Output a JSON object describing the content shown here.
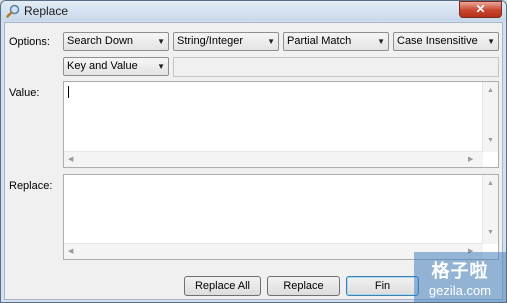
{
  "window": {
    "title": "Replace",
    "close_glyph": "✕"
  },
  "options": {
    "label": "Options:",
    "direction": "Search Down",
    "data_type": "String/Integer",
    "match": "Partial Match",
    "case": "Case Insensitive",
    "scope": "Key and Value",
    "extra_field_value": ""
  },
  "value": {
    "label": "Value:",
    "text": ""
  },
  "replace": {
    "label": "Replace:",
    "text": ""
  },
  "buttons": {
    "replace_all": "Replace All",
    "replace": "Replace",
    "find": "Fin"
  },
  "watermark": {
    "text": "格子啦",
    "url": "gezila.com"
  },
  "colors": {
    "accent": "#3c7fb1",
    "titlebar": "#c8d7eb",
    "close": "#c8452f"
  }
}
